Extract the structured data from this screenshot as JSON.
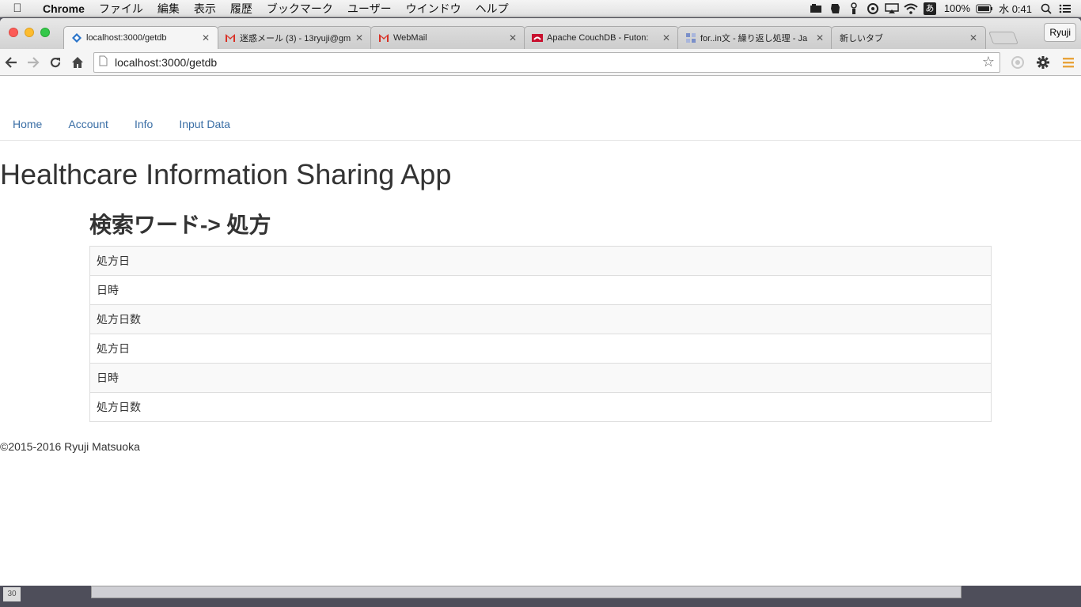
{
  "menubar": {
    "app_name": "Chrome",
    "items": [
      "ファイル",
      "編集",
      "表示",
      "履歴",
      "ブックマーク",
      "ユーザー",
      "ウインドウ",
      "ヘルプ"
    ],
    "battery": "100%",
    "ime": "あ",
    "clock": "水 0:41"
  },
  "browser": {
    "tabs": [
      {
        "title": "localhost:3000/getdb",
        "icon": "diamond-icon"
      },
      {
        "title": "迷惑メール (3) - 13ryuji@gm",
        "icon": "gmail-icon"
      },
      {
        "title": "WebMail",
        "icon": "gmail-icon"
      },
      {
        "title": "Apache CouchDB - Futon:",
        "icon": "couchdb-icon"
      },
      {
        "title": "for..in文 - 繰り返し処理 - Ja",
        "icon": "grid-icon"
      },
      {
        "title": "新しいタブ",
        "icon": ""
      }
    ],
    "profile": "Ryuji",
    "url": "localhost:3000/getdb",
    "accent": "#e8a33a"
  },
  "page": {
    "nav": [
      "Home",
      "Account",
      "Info",
      "Input Data"
    ],
    "title": "Healthcare Information Sharing App",
    "section_title": "検索ワード-> 処方",
    "rows": [
      "処方日",
      "日時",
      "処方日数",
      "処方日",
      "日時",
      "処方日数"
    ],
    "footer": "©2015-2016 Ryuji Matsuoka",
    "link_color": "#3a6ea5"
  },
  "desktop": {
    "corner_number": "30"
  }
}
